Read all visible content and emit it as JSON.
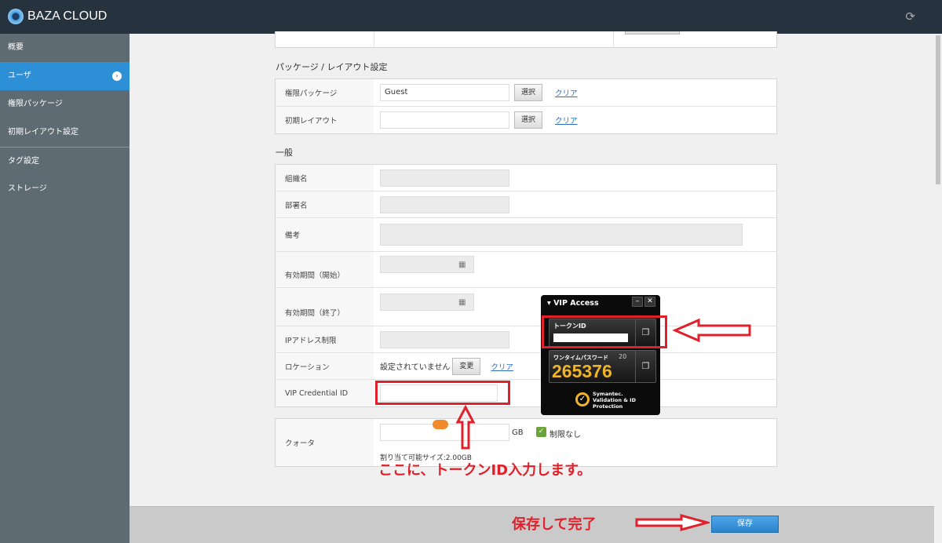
{
  "app": {
    "title": "BAZA CLOUD"
  },
  "sidebar": {
    "items": [
      {
        "label": "概要"
      },
      {
        "label": "ユーザ"
      },
      {
        "label": "権限パッケージ"
      },
      {
        "label": "初期レイアウト設定"
      },
      {
        "label": "タグ設定"
      },
      {
        "label": "ストレージ"
      }
    ]
  },
  "package": {
    "heading": "パッケージ / レイアウト設定",
    "rows": [
      {
        "label": "権限パッケージ",
        "value": "Guest",
        "select": "選択",
        "clear": "クリア"
      },
      {
        "label": "初期レイアウト",
        "value": "",
        "select": "選択",
        "clear": "クリア"
      }
    ]
  },
  "general": {
    "heading": "一般",
    "org": "組織名",
    "dept": "部署名",
    "note": "備考",
    "start": "有効期間（開始）",
    "end": "有効期間（終了）",
    "ip": "IPアドレス制限",
    "location": {
      "label": "ロケーション",
      "value": "設定されていません",
      "change": "変更",
      "clear": "クリア"
    },
    "vip": {
      "label": "VIP Credential ID",
      "value": ""
    }
  },
  "quota": {
    "label": "クォータ",
    "value": "",
    "unit": "GB",
    "unlimited": "制限なし",
    "unlimited_checked": true,
    "available": "割り当て可能サイズ:2.00GB"
  },
  "footer": {
    "save": "保存"
  },
  "vip_access": {
    "title": "VIP Access",
    "token_label": "トークンID",
    "otp_label": "ワンタイムパスワード",
    "otp": "265376",
    "countdown": "20",
    "brand": "Symantec. Validation & ID Protection"
  },
  "annotations": {
    "token_hint": "ここに、トークンID入力します。",
    "save_hint": "保存して完了"
  }
}
